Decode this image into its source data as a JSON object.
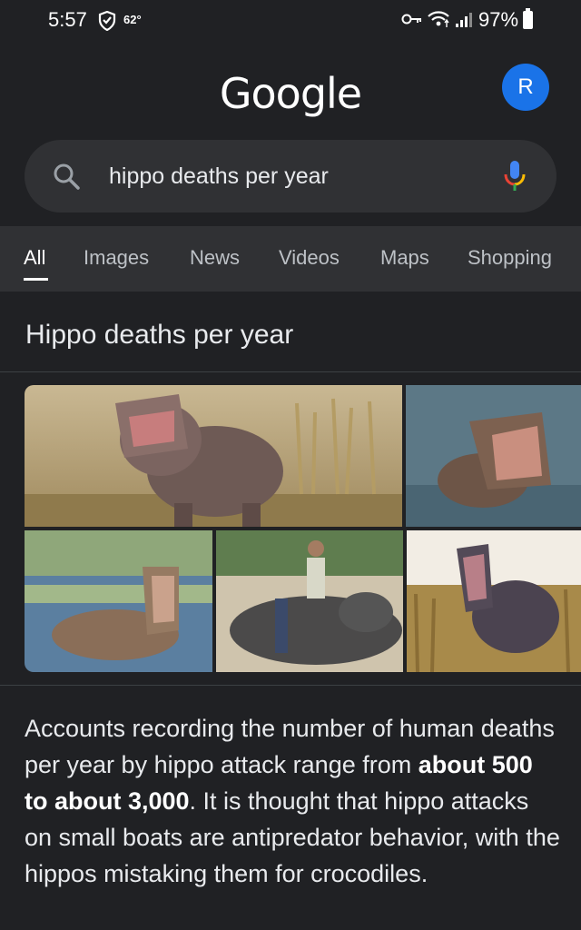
{
  "status": {
    "time": "5:57",
    "temperature": "62°",
    "battery": "97%"
  },
  "logo_text": "Google",
  "avatar_letter": "R",
  "search": {
    "query": "hippo deaths per year"
  },
  "tabs": [
    {
      "label": "All",
      "active": true
    },
    {
      "label": "Images",
      "active": false
    },
    {
      "label": "News",
      "active": false
    },
    {
      "label": "Videos",
      "active": false
    },
    {
      "label": "Maps",
      "active": false
    },
    {
      "label": "Shopping",
      "active": false
    }
  ],
  "result": {
    "title": "Hippo deaths per year",
    "answer_before": "Accounts recording the number of human deaths per year by hippo attack range from ",
    "answer_bold": "about 500 to about 3,000",
    "answer_after": ". It is thought that hippo attacks on small boats are antipredator behavior, with the hippos mistaking them for crocodiles."
  },
  "colors": {
    "background": "#202124",
    "surface": "#303134",
    "avatar": "#1a73e8",
    "text": "#e8eaed"
  }
}
